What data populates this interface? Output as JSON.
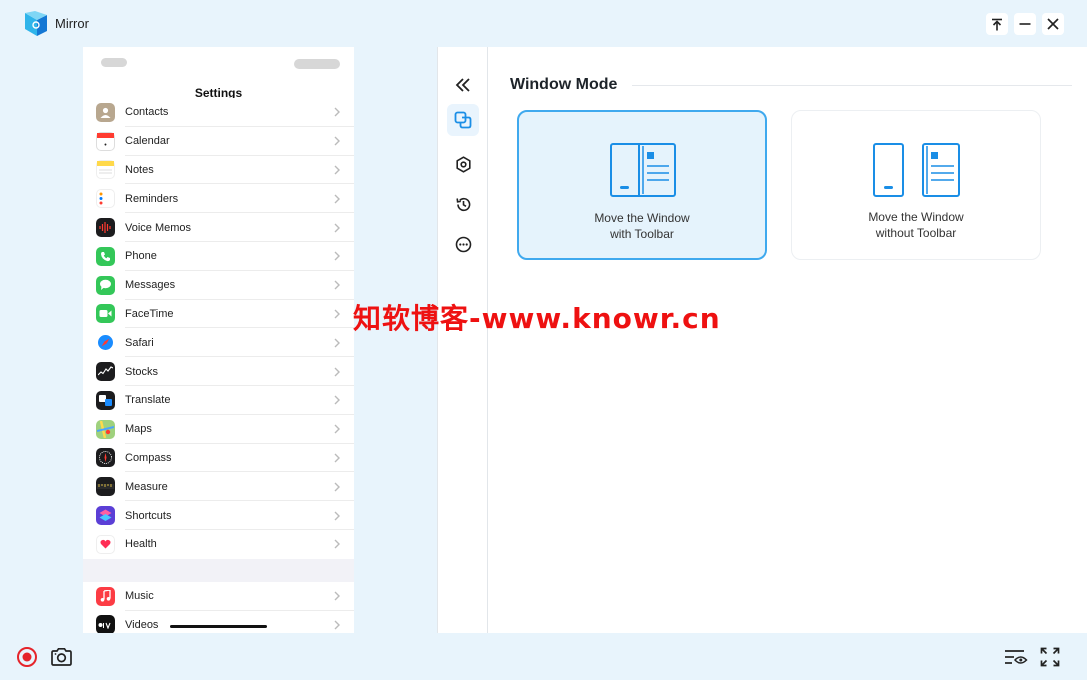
{
  "app": {
    "title": "Mirror",
    "accent_color": "#3fa9ee",
    "logo_icon": "mirror-logo-icon"
  },
  "window_controls": [
    {
      "name": "pin-button",
      "icon": "pin-icon"
    },
    {
      "name": "minimize-button",
      "icon": "minimize-icon"
    },
    {
      "name": "close-button",
      "icon": "close-icon"
    }
  ],
  "phone": {
    "header_title": "Settings",
    "settings_items": [
      {
        "label": "Contacts",
        "icon": "contacts-icon",
        "color": "#b8a78f"
      },
      {
        "label": "Calendar",
        "icon": "calendar-icon",
        "color": "#ffffff"
      },
      {
        "label": "Notes",
        "icon": "notes-icon",
        "color": "#ffd94a"
      },
      {
        "label": "Reminders",
        "icon": "reminders-icon",
        "color": "#ffffff"
      },
      {
        "label": "Voice Memos",
        "icon": "voice-memos-icon",
        "color": "#1c1c1e"
      },
      {
        "label": "Phone",
        "icon": "phone-icon",
        "color": "#34c759"
      },
      {
        "label": "Messages",
        "icon": "messages-icon",
        "color": "#34c759"
      },
      {
        "label": "FaceTime",
        "icon": "facetime-icon",
        "color": "#34c759"
      },
      {
        "label": "Safari",
        "icon": "safari-icon",
        "color": "#e8f1fb"
      },
      {
        "label": "Stocks",
        "icon": "stocks-icon",
        "color": "#1c1c1e"
      },
      {
        "label": "Translate",
        "icon": "translate-icon",
        "color": "#1c1c1e"
      },
      {
        "label": "Maps",
        "icon": "maps-icon",
        "color": "#9fd17d"
      },
      {
        "label": "Compass",
        "icon": "compass-icon",
        "color": "#1c1c1e"
      },
      {
        "label": "Measure",
        "icon": "measure-icon",
        "color": "#1c1c1e"
      },
      {
        "label": "Shortcuts",
        "icon": "shortcuts-icon",
        "color": "#5b3fd6"
      },
      {
        "label": "Health",
        "icon": "health-icon",
        "color": "#ffffff"
      }
    ],
    "settings_items_2": [
      {
        "label": "Music",
        "icon": "music-icon",
        "color": "#fc3c44"
      },
      {
        "label": "Videos",
        "icon": "tv-icon",
        "color": "#111111"
      }
    ]
  },
  "toolbar": {
    "items": [
      {
        "name": "collapse-button",
        "icon": "double-chevron-left-icon",
        "active": false
      },
      {
        "name": "window-mode-button",
        "icon": "window-mode-icon",
        "active": true
      },
      {
        "name": "settings-button",
        "icon": "gear-icon",
        "active": false
      },
      {
        "name": "history-button",
        "icon": "history-icon",
        "active": false
      },
      {
        "name": "more-button",
        "icon": "more-icon",
        "active": false
      }
    ]
  },
  "window_mode": {
    "title": "Window Mode",
    "options": [
      {
        "line1": "Move the Window",
        "line2": "with Toolbar",
        "selected": true
      },
      {
        "line1": "Move the Window",
        "line2": "without Toolbar",
        "selected": false
      }
    ]
  },
  "watermark": "知软博客-www.knowr.cn",
  "bottom_left": [
    {
      "name": "record-button",
      "icon": "record-icon"
    },
    {
      "name": "screenshot-button",
      "icon": "camera-icon"
    }
  ],
  "bottom_right": [
    {
      "name": "display-settings-button",
      "icon": "display-eye-icon"
    },
    {
      "name": "fullscreen-button",
      "icon": "fullscreen-icon"
    }
  ]
}
